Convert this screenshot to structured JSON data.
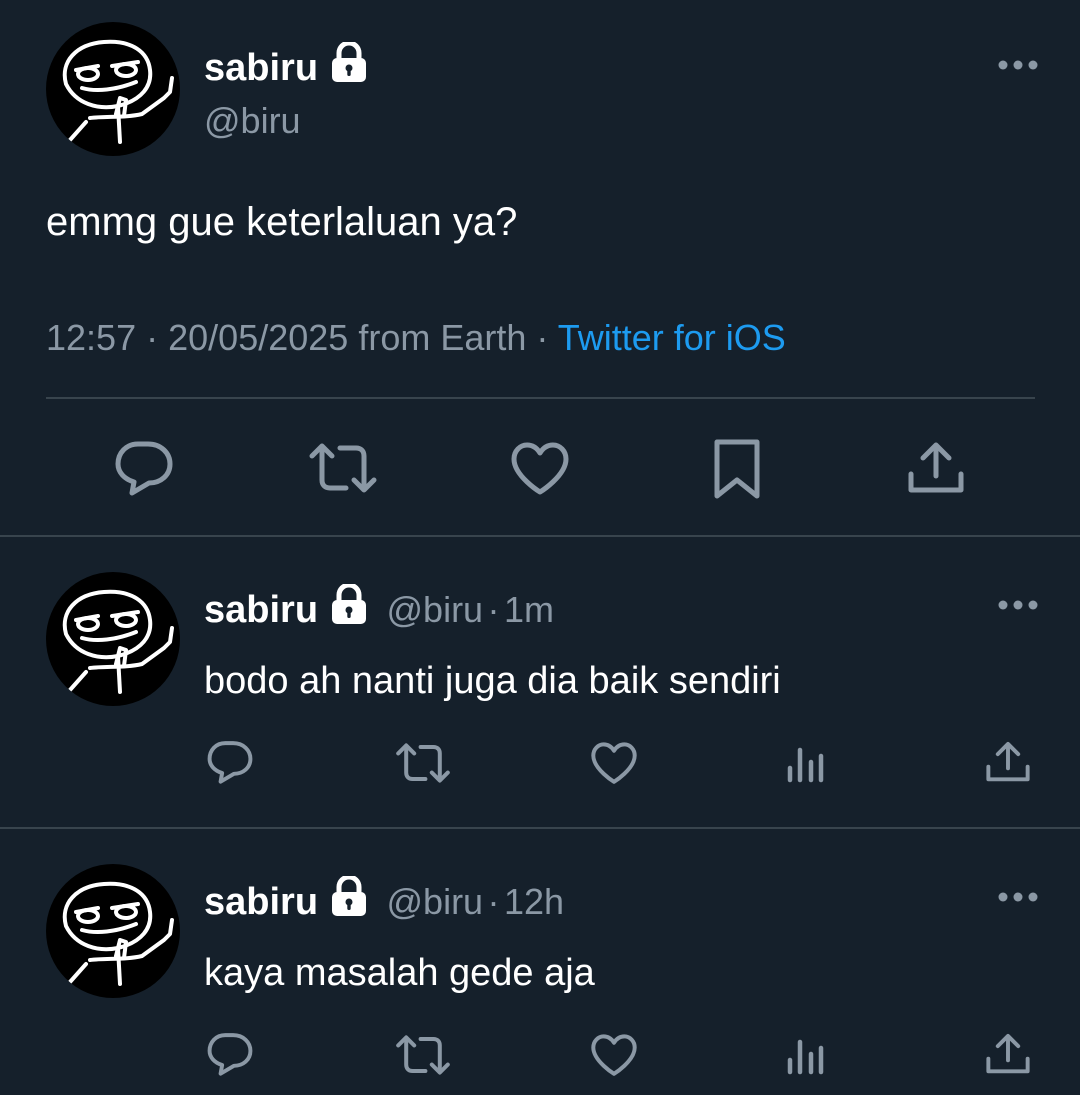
{
  "main_tweet": {
    "display_name": "sabiru",
    "handle": "@biru",
    "text": "emmg gue keterlaluan ya?",
    "time": "12:57",
    "date": "20/05/2025",
    "location": "from Earth",
    "separator": "·",
    "client": "Twitter for iOS",
    "actions": [
      "reply-icon",
      "retweet-icon",
      "like-icon",
      "bookmark-icon",
      "share-icon"
    ]
  },
  "replies": [
    {
      "display_name": "sabiru",
      "handle": "@biru",
      "separator": "·",
      "time_ago": "1m",
      "text": "bodo ah nanti juga dia baik sendiri",
      "actions": [
        "reply-icon",
        "retweet-icon",
        "like-icon",
        "views-icon",
        "share-icon"
      ]
    },
    {
      "display_name": "sabiru",
      "handle": "@biru",
      "separator": "·",
      "time_ago": "12h",
      "text": "kaya masalah gede aja",
      "actions": [
        "reply-icon",
        "retweet-icon",
        "like-icon",
        "views-icon",
        "share-icon"
      ]
    }
  ],
  "colors": {
    "background": "#15202b",
    "text": "#ffffff",
    "secondary": "#8b98a5",
    "link": "#1d9bf0",
    "divider": "#38444d"
  }
}
